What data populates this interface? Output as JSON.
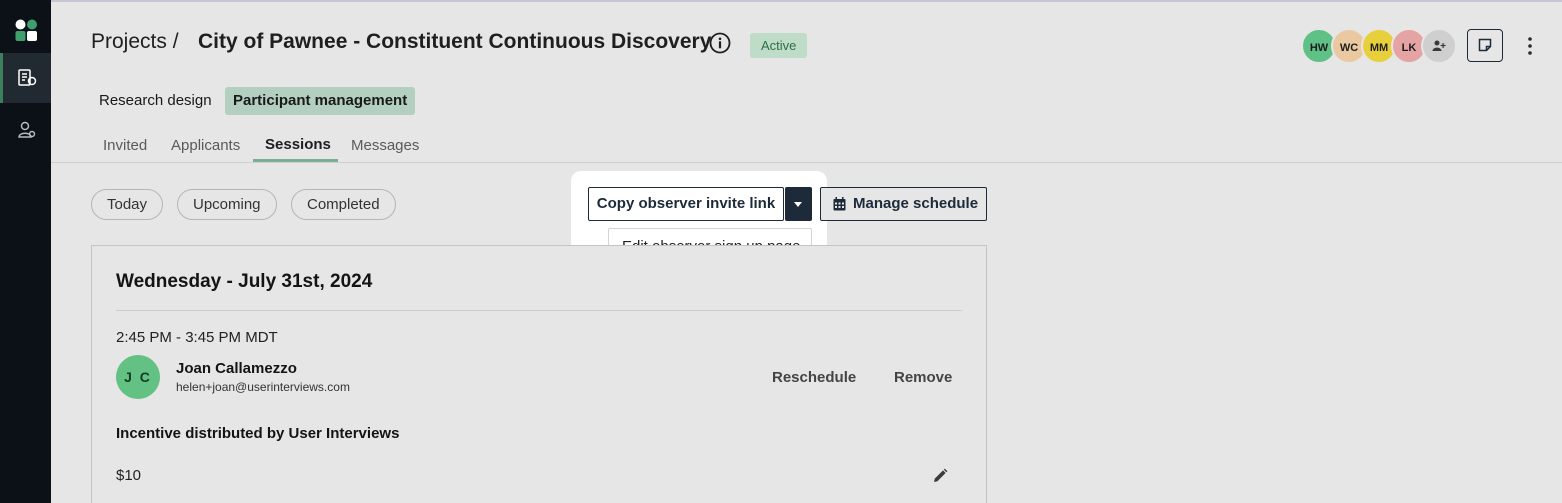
{
  "header": {
    "breadcrumb": "Projects /",
    "project_title": "City of Pawnee - Constituent Continuous Discovery",
    "status": "Active",
    "avatars": [
      {
        "initials": "HW",
        "color": "#5fc185"
      },
      {
        "initials": "WC",
        "color": "#ebc9a0"
      },
      {
        "initials": "MM",
        "color": "#e8cf3c"
      },
      {
        "initials": "LK",
        "color": "#e6a3a4"
      }
    ]
  },
  "sections": {
    "research_design": "Research design",
    "participant_management": "Participant management"
  },
  "tabs": [
    {
      "label": "Invited"
    },
    {
      "label": "Applicants"
    },
    {
      "label": "Sessions"
    },
    {
      "label": "Messages"
    }
  ],
  "filters": [
    {
      "label": "Today"
    },
    {
      "label": "Upcoming"
    },
    {
      "label": "Completed"
    }
  ],
  "actions": {
    "copy_invite": "Copy observer invite link",
    "edit_signup": "Edit observer sign up page",
    "manage_schedule": "Manage schedule"
  },
  "session": {
    "day": "Wednesday - July 31st, 2024",
    "time": "2:45 PM - 3:45 PM MDT",
    "participant": {
      "initials": "J C",
      "name": "Joan Callamezzo",
      "email": "helen+joan@userinterviews.com"
    },
    "reschedule": "Reschedule",
    "remove": "Remove",
    "incentive_label": "Incentive distributed by User Interviews",
    "incentive_amount": "$10"
  }
}
